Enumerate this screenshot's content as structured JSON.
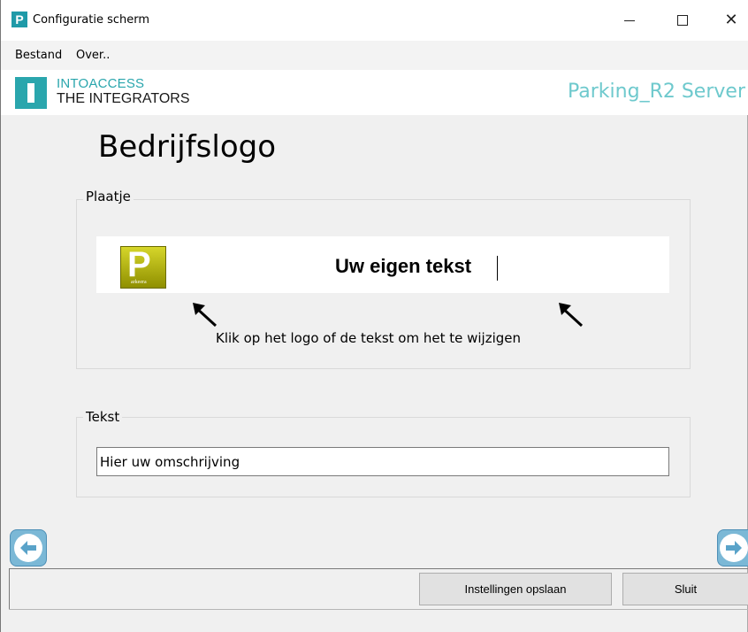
{
  "window": {
    "title": "Configuratie scherm",
    "app_icon_letter": "P",
    "controls": {
      "minimize": "minimize-icon",
      "maximize": "maximize-icon",
      "close": "close-icon"
    }
  },
  "menu": {
    "items": [
      "Bestand",
      "Over.."
    ]
  },
  "header": {
    "brand_line1": "INTOACCESS",
    "brand_line2": "THE INTEGRATORS",
    "server_name": "Parking_R2 Server",
    "accent_color": "#2aa6ad"
  },
  "main": {
    "title": "Bedrijfslogo",
    "image_group": {
      "legend": "Plaatje",
      "logo_letter": "P",
      "logo_caption": "arkeera",
      "custom_text": "Uw eigen tekst",
      "hint": "Klik op het logo of de tekst om het te wijzigen"
    },
    "text_group": {
      "legend": "Tekst",
      "description_value": "Hier uw omschrijving"
    }
  },
  "navigation": {
    "prev_icon": "arrow-left-circle-icon",
    "next_icon": "arrow-right-circle-icon"
  },
  "footer": {
    "save_label": "Instellingen opslaan",
    "close_label": "Sluit"
  }
}
